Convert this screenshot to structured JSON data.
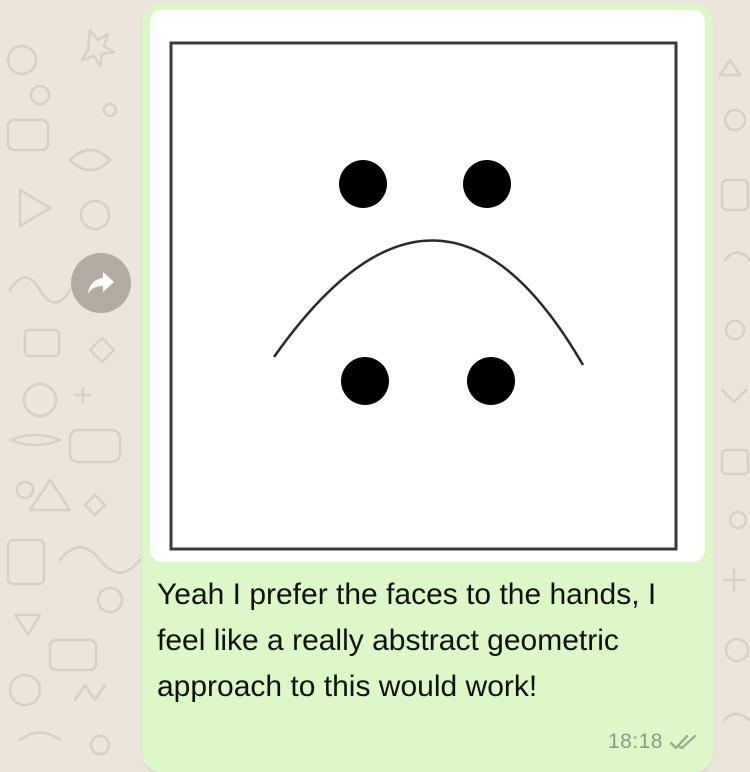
{
  "chat": {
    "background_color": "#ece5dc",
    "doodle_color": "#d9d1c6"
  },
  "message": {
    "direction": "outgoing",
    "bubble_color": "#dcf8c6",
    "image": {
      "description_icon": "sad-face-diagram",
      "frame_color": "#3a3a3a",
      "dot_color": "#000000"
    },
    "caption": "Yeah I prefer the faces to the hands, I feel like a really abstract geometric approach to this would work!",
    "time": "18:18",
    "status_icon": "double-check-icon",
    "status_color": "#9aa593"
  },
  "actions": {
    "forward_icon": "forward-arrow-icon",
    "forward_color": "#b2aba2"
  }
}
